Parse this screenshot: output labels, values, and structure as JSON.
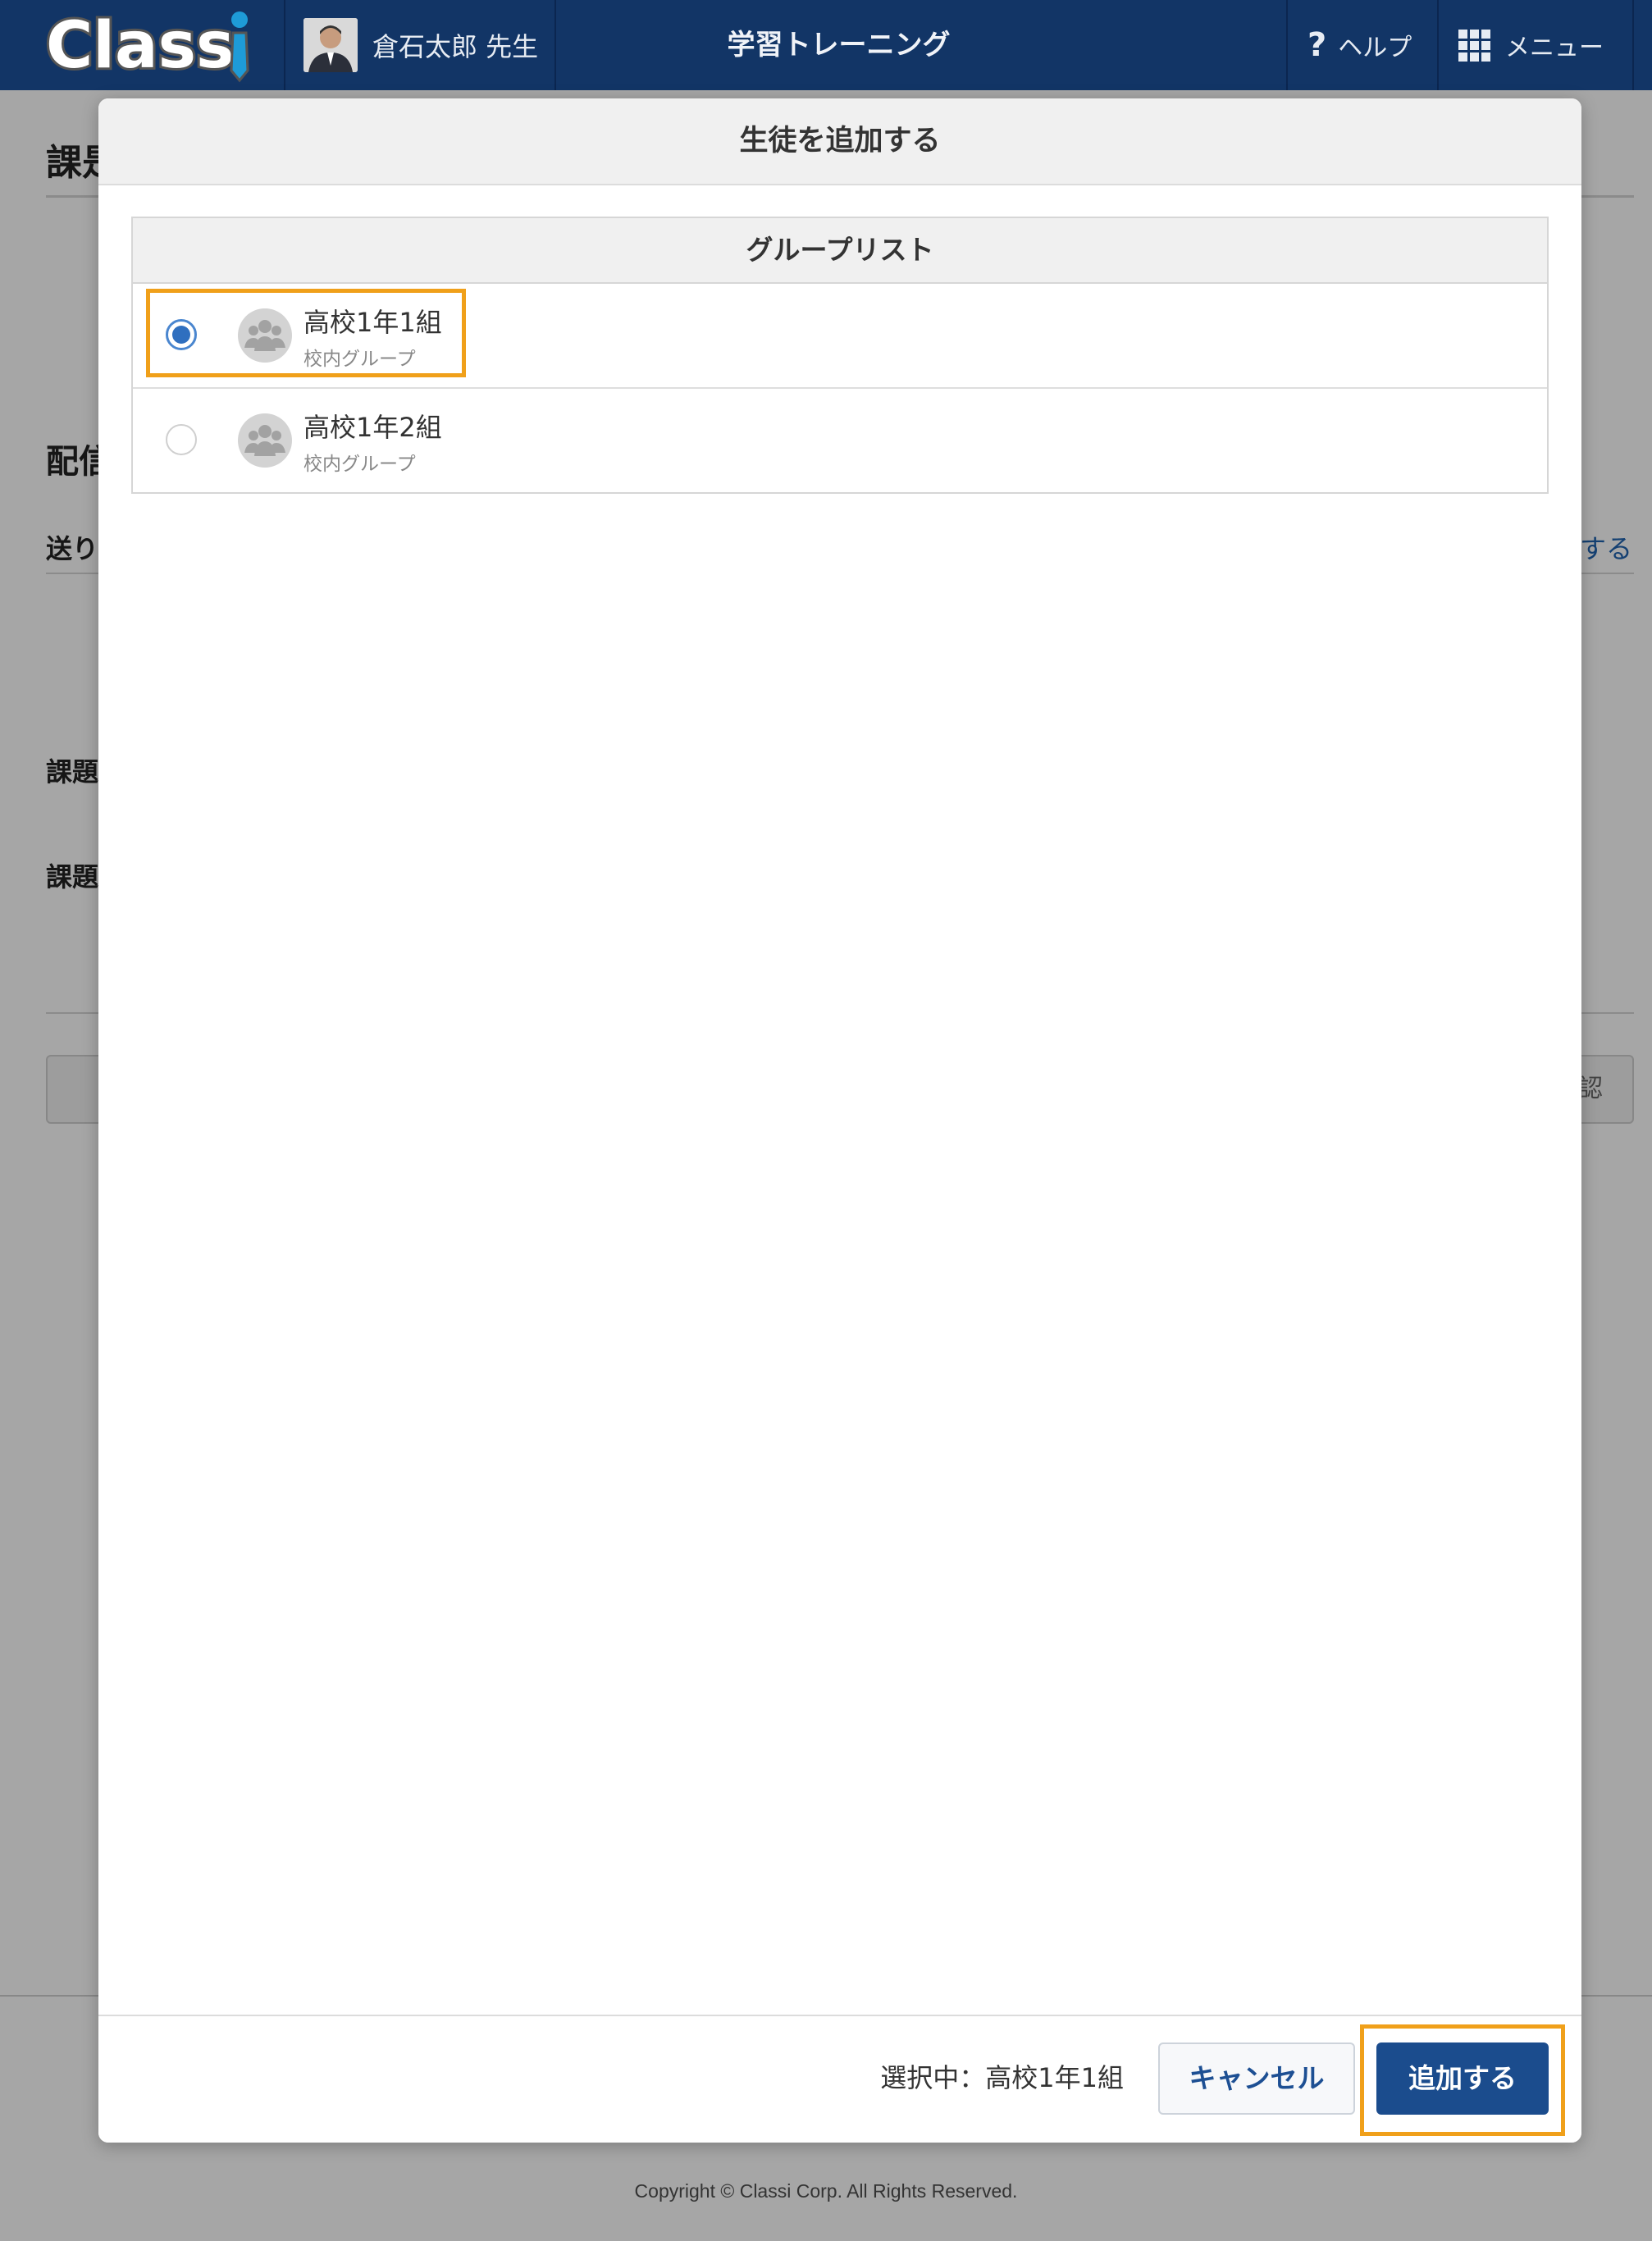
{
  "header": {
    "logo_text": "Classi",
    "teacher_name": "倉石太郎 先生",
    "app_title": "学習トレーニング",
    "help_label": "ヘルプ",
    "menu_label": "メニュー"
  },
  "background_page": {
    "title_fragment": "課是",
    "section_fragment": "配信",
    "send_label_fragment": "送り",
    "link_fragment": "する",
    "task_label_1": "課題",
    "task_label_2": "課題",
    "button_fragment": "認",
    "copyright": "Copyright © Classi Corp. All Rights Reserved."
  },
  "modal": {
    "title": "生徒を追加する",
    "list_header": "グループリスト",
    "groups": [
      {
        "name": "高校1年1組",
        "type": "校内グループ",
        "selected": true
      },
      {
        "name": "高校1年2組",
        "type": "校内グループ",
        "selected": false
      }
    ],
    "selected_text": "選択中：高校1年1組",
    "cancel_label": "キャンセル",
    "add_label": "追加する"
  },
  "colors": {
    "header_bg": "#123566",
    "primary_button": "#1b4c8d",
    "highlight": "#f0a01a",
    "radio_checked": "#2f6fbf"
  }
}
